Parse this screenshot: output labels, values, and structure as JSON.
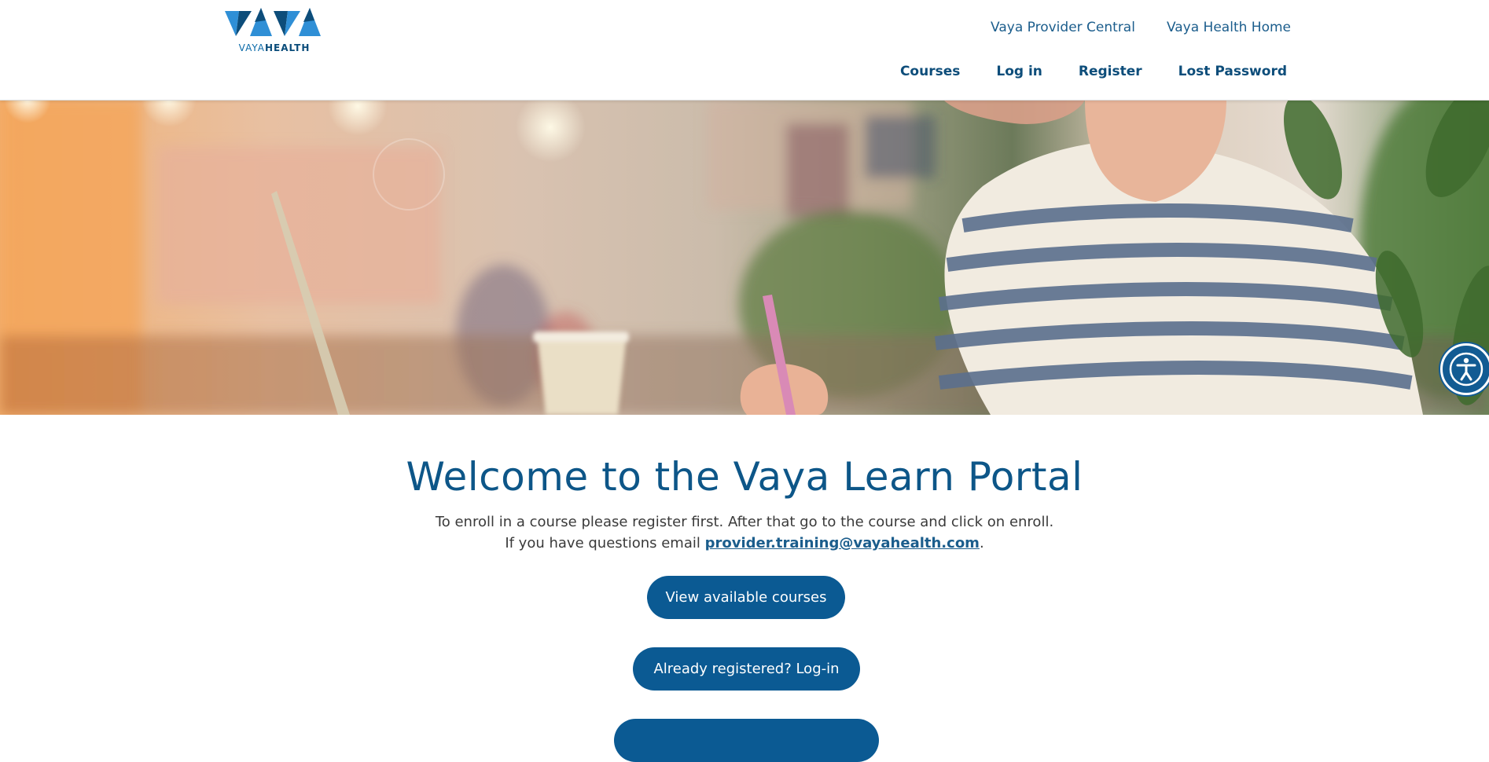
{
  "header": {
    "logo": {
      "wordmark_primary": "VAYA",
      "wordmark_secondary": "HEALTH",
      "colors": {
        "light": "#2f8fd6",
        "dark": "#0d4d7a"
      }
    },
    "util_nav": [
      {
        "label": "Vaya Provider Central"
      },
      {
        "label": "Vaya Health Home"
      }
    ],
    "main_nav": [
      {
        "label": "Courses"
      },
      {
        "label": "Log in"
      },
      {
        "label": "Register"
      },
      {
        "label": "Lost Password"
      }
    ]
  },
  "hero": {
    "alt": "Person writing at a cafe table with a laptop and coffee cup"
  },
  "accessibility": {
    "icon": "accessibility-icon"
  },
  "welcome": {
    "title": "Welcome to the Vaya Learn Portal",
    "line1": "To enroll in a course please register first. After that go to the course and click on enroll.",
    "line2_prefix": "If you have questions email ",
    "email": "provider.training@vayahealth.com",
    "line2_suffix": "."
  },
  "buttons": {
    "view_courses": "View available courses",
    "login": "Already registered? Log-in",
    "third": ""
  },
  "colors": {
    "brand": "#0b5a93",
    "nav_text": "#0d4d7a",
    "title": "#0d5688"
  }
}
